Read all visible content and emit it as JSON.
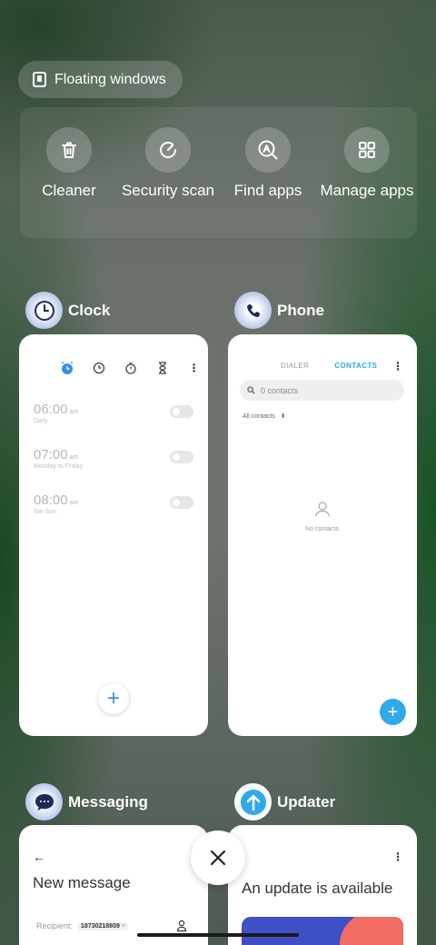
{
  "floating_windows": {
    "label": "Floating windows",
    "icon": "floating-window-icon"
  },
  "tools": [
    {
      "label": "Cleaner",
      "icon": "trash-icon"
    },
    {
      "label": "Security scan",
      "icon": "security-scan-icon"
    },
    {
      "label": "Find apps",
      "icon": "find-apps-icon"
    },
    {
      "label": "Manage apps",
      "icon": "grid-icon"
    }
  ],
  "apps": {
    "clock": {
      "name": "Clock",
      "alarms": [
        {
          "time": "06:00",
          "ampm": "am",
          "repeat": "Daily"
        },
        {
          "time": "07:00",
          "ampm": "am",
          "repeat": "Monday to Friday"
        },
        {
          "time": "08:00",
          "ampm": "am",
          "repeat": "Sat Sun"
        }
      ],
      "fab": "+"
    },
    "phone": {
      "name": "Phone",
      "tabs": [
        "DIALER",
        "CONTACTS"
      ],
      "active_tab": "CONTACTS",
      "search_placeholder": "0 contacts",
      "filter": "All contacts",
      "empty_text": "No contacts",
      "fab": "+"
    },
    "messaging": {
      "name": "Messaging",
      "title": "New message",
      "recipient_label": "Recipient:",
      "recipient_chip": "18730218809",
      "chip_remove": "×"
    },
    "updater": {
      "name": "Updater",
      "title": "An update is available"
    }
  },
  "colors": {
    "accent_blue": "#2da7e0",
    "clock_active_blue": "#2f8ff0",
    "updater_banner_blue": "#3f4fc4",
    "updater_banner_coral": "#f26d62"
  }
}
